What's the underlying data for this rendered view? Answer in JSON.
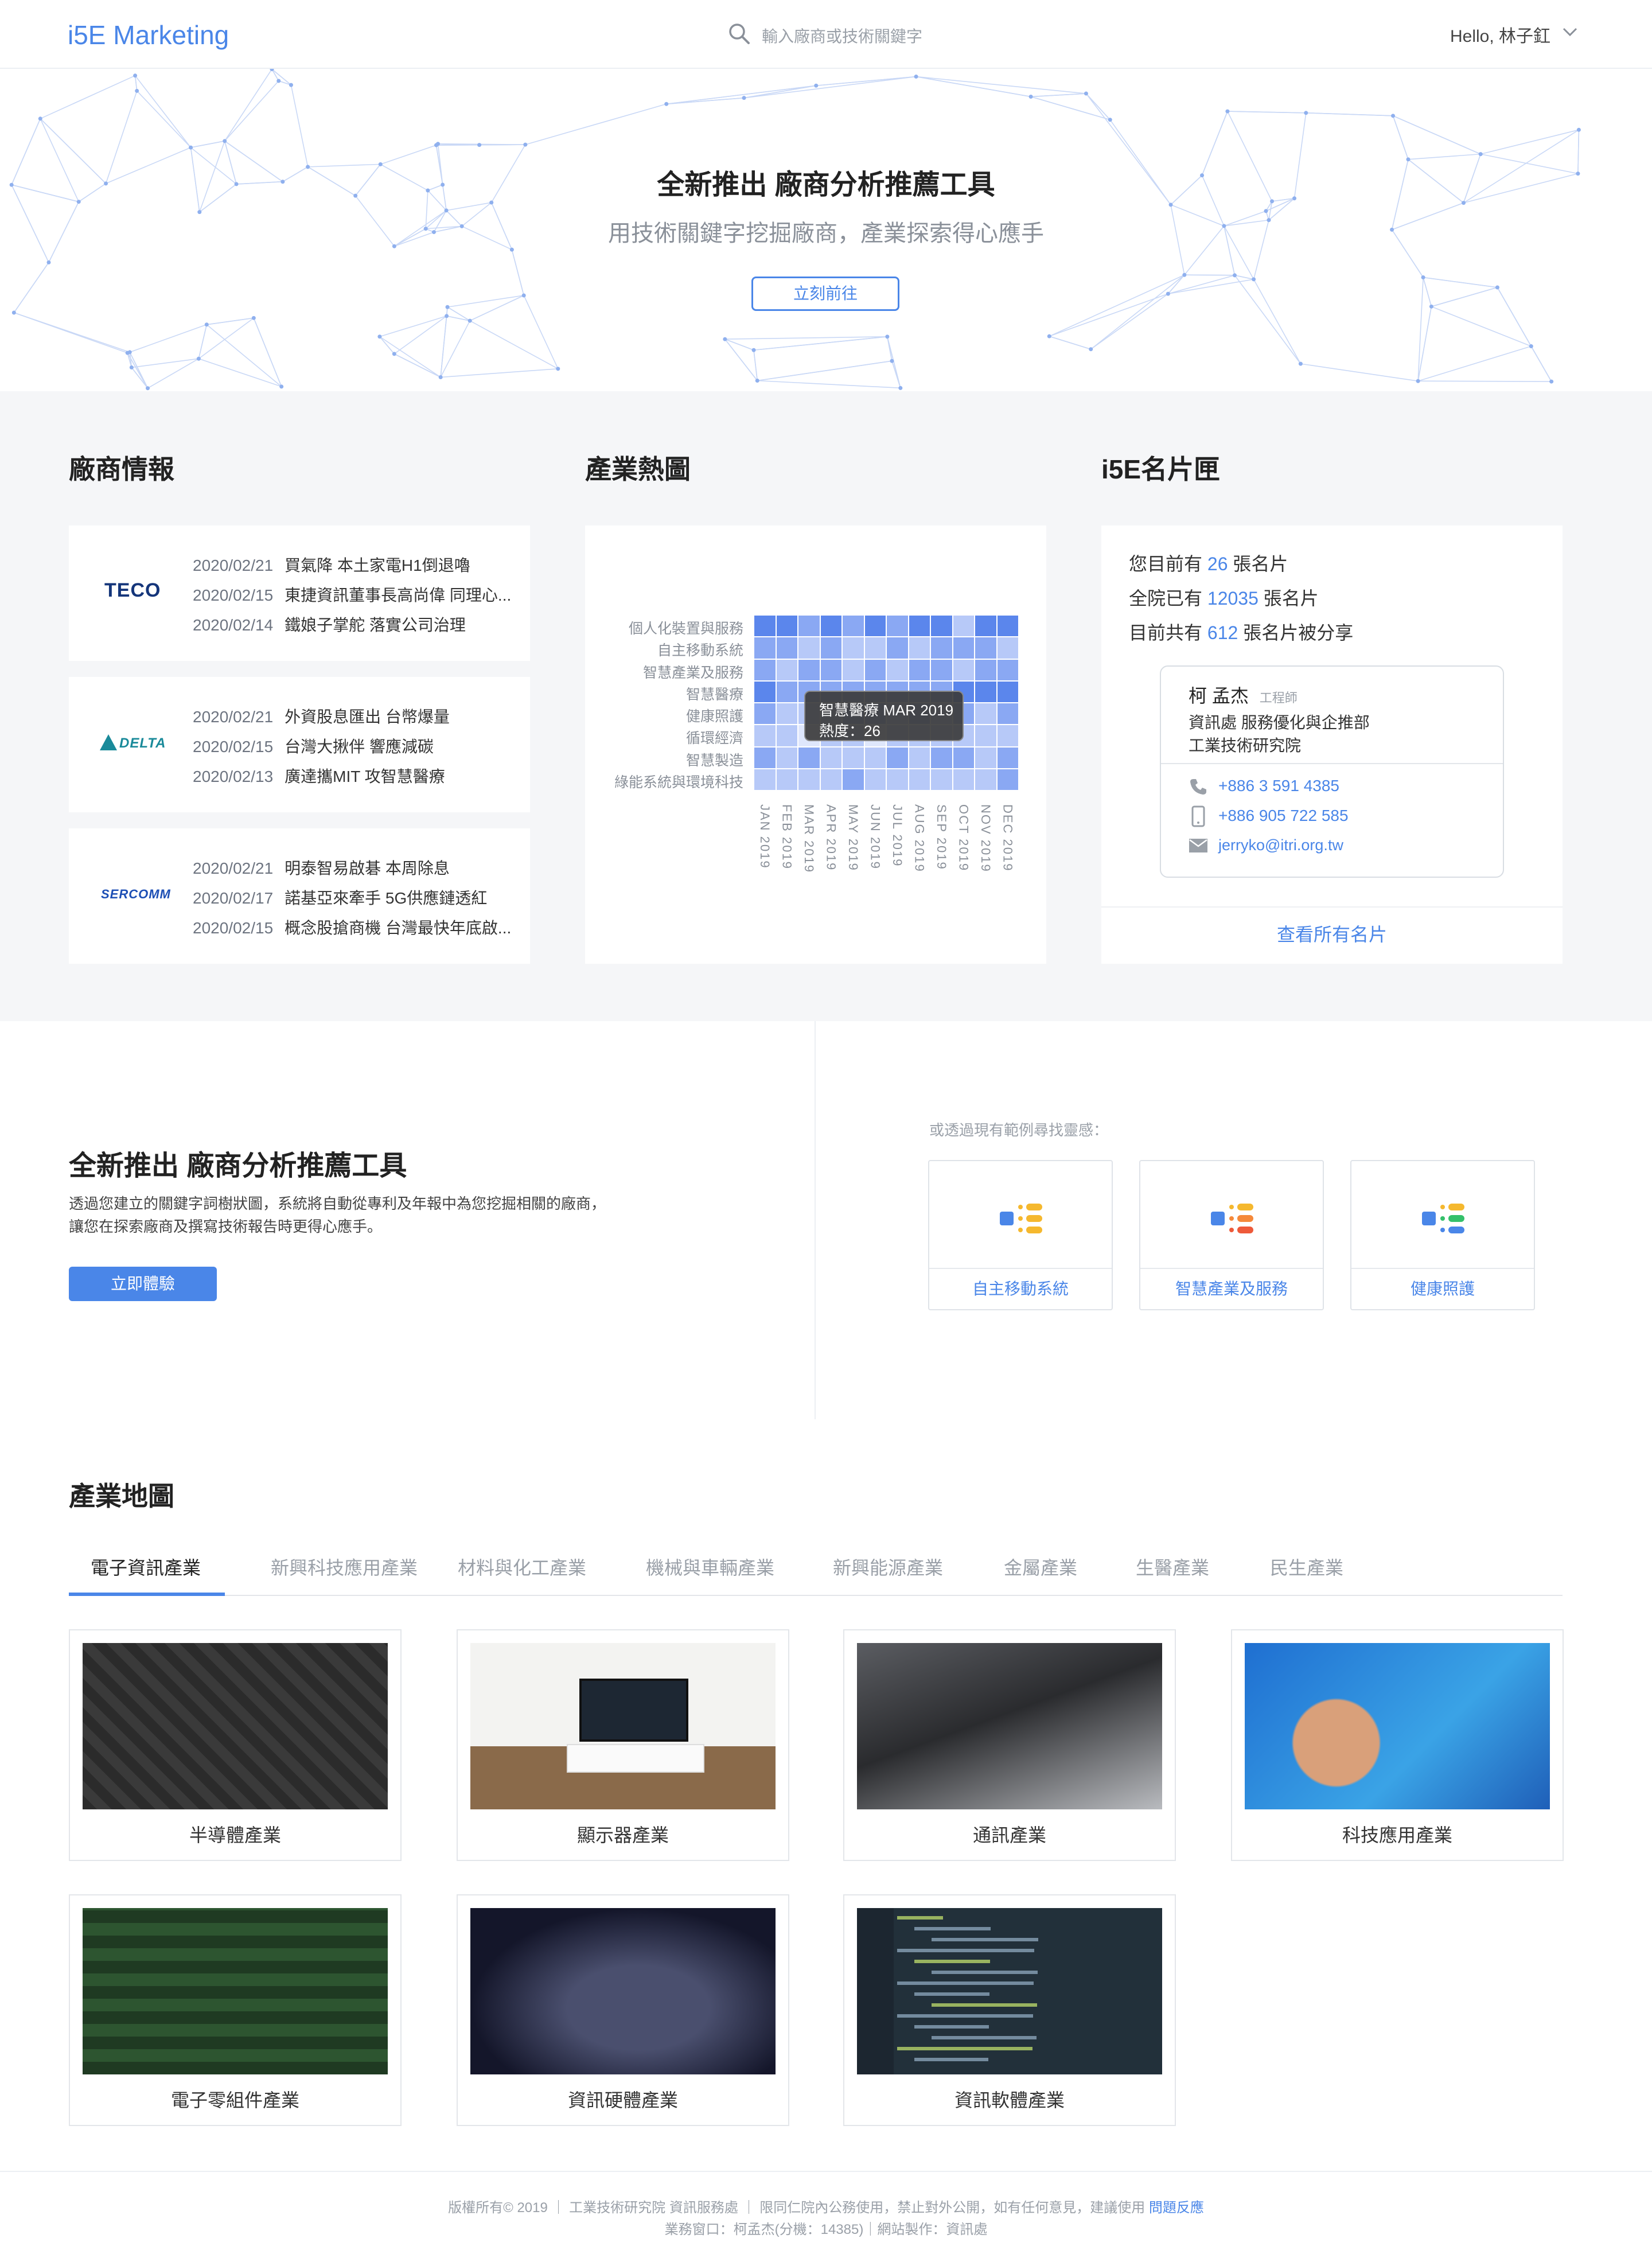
{
  "header": {
    "logo": "i5E Marketing",
    "search_placeholder": "輸入廠商或技術關鍵字",
    "user_greeting": "Hello, 林子釭"
  },
  "hero": {
    "title": "全新推出 廠商分析推薦工具",
    "subtitle": "用技術關鍵字挖掘廠商，產業探索得心應手",
    "button": "立刻前往"
  },
  "vendor_news": {
    "title": "廠商情報",
    "cards": [
      {
        "logo": "TECO",
        "items": [
          {
            "date": "2020/02/21",
            "text": "買氣降 本土家電H1倒退嚕"
          },
          {
            "date": "2020/02/15",
            "text": "東捷資訊董事長高尚偉 同理心..."
          },
          {
            "date": "2020/02/14",
            "text": "鐵娘子掌舵 落實公司治理"
          }
        ]
      },
      {
        "logo": "DELTA",
        "items": [
          {
            "date": "2020/02/21",
            "text": "外資股息匯出 台幣爆量"
          },
          {
            "date": "2020/02/15",
            "text": "台灣大揪伴 響應減碳"
          },
          {
            "date": "2020/02/13",
            "text": "廣達攜MIT 攻智慧醫療"
          }
        ]
      },
      {
        "logo": "SERCOMM",
        "items": [
          {
            "date": "2020/02/21",
            "text": "明泰智易啟碁 本周除息"
          },
          {
            "date": "2020/02/17",
            "text": "諾基亞來牽手 5G供應鏈透紅"
          },
          {
            "date": "2020/02/15",
            "text": "概念股搶商機 台灣最快年底啟..."
          }
        ]
      }
    ]
  },
  "heatmap": {
    "title": "產業熱圖",
    "rows": [
      "個人化裝置與服務",
      "自主移動系統",
      "智慧產業及服務",
      "智慧醫療",
      "健康照護",
      "循環經濟",
      "智慧製造",
      "綠能系統與環境科技"
    ],
    "months": [
      "JAN 2019",
      "FEB 2019",
      "MAR 2019",
      "APR 2019",
      "MAY 2019",
      "JUN 2019",
      "JUL 2019",
      "AUG 2019",
      "SEP 2019",
      "OCT 2019",
      "NOV 2019",
      "DEC 2019"
    ],
    "tooltip_title": "智慧醫療 MAR 2019",
    "tooltip_value": "熱度：26",
    "colors": [
      "#ffffff",
      "#dfe7fc",
      "#b7c9f8",
      "#8aa8f3",
      "#5b86ec"
    ]
  },
  "chart_data": {
    "type": "heatmap",
    "x": [
      "JAN 2019",
      "FEB 2019",
      "MAR 2019",
      "APR 2019",
      "MAY 2019",
      "JUN 2019",
      "JUL 2019",
      "AUG 2019",
      "SEP 2019",
      "OCT 2019",
      "NOV 2019",
      "DEC 2019"
    ],
    "y": [
      "個人化裝置與服務",
      "自主移動系統",
      "智慧產業及服務",
      "智慧醫療",
      "健康照護",
      "循環經濟",
      "智慧製造",
      "綠能系統與環境科技"
    ],
    "levels": [
      [
        4,
        4,
        3,
        4,
        3,
        4,
        3,
        4,
        4,
        2,
        4,
        4
      ],
      [
        3,
        3,
        2,
        3,
        2,
        2,
        3,
        2,
        3,
        3,
        3,
        2
      ],
      [
        3,
        2,
        3,
        3,
        2,
        3,
        2,
        3,
        3,
        2,
        3,
        3
      ],
      [
        4,
        3,
        3,
        3,
        3,
        3,
        3,
        3,
        3,
        4,
        4,
        4
      ],
      [
        3,
        2,
        2,
        2,
        3,
        3,
        2,
        3,
        2,
        3,
        2,
        3
      ],
      [
        2,
        2,
        1,
        2,
        2,
        1,
        2,
        2,
        2,
        2,
        2,
        2
      ],
      [
        3,
        2,
        3,
        2,
        2,
        2,
        3,
        2,
        3,
        3,
        2,
        3
      ],
      [
        2,
        2,
        2,
        2,
        3,
        2,
        2,
        2,
        2,
        2,
        2,
        3
      ]
    ],
    "tooltip": {
      "row": "智慧醫療",
      "month": "MAR 2019",
      "value": 26
    }
  },
  "business_cards": {
    "title": "i5E名片匣",
    "stat1_pre": "您目前有",
    "stat1_num": "26",
    "stat1_post": "張名片",
    "stat2_pre": "全院已有",
    "stat2_num": "12035",
    "stat2_post": "張名片",
    "stat3_pre": "目前共有",
    "stat3_num": "612",
    "stat3_post": "張名片被分享",
    "card": {
      "name": "柯 孟杰",
      "role": "工程師",
      "dept": "資訊處 服務優化與企推部",
      "org": "工業技術研究院",
      "phone": "+886 3 591 4385",
      "mobile": "+886 905 722 585",
      "email": "jerryko@itri.org.tw"
    },
    "view_all": "查看所有名片"
  },
  "promo": {
    "title": "全新推出 廠商分析推薦工具",
    "desc_line1": "透過您建立的關鍵字詞樹狀圖，系統將自動從專利及年報中為您挖掘相關的廠商，",
    "desc_line2": "讓您在探索廠商及撰寫技術報告時更得心應手。",
    "button": "立即體驗",
    "examples_title": "或透過現有範例尋找靈感：",
    "examples": [
      {
        "label": "自主移動系統",
        "colors": [
          "#4a86e8",
          "#f5b82e",
          "#f5b82e",
          "#f5b82e"
        ]
      },
      {
        "label": "智慧產業及服務",
        "colors": [
          "#4a86e8",
          "#f5b82e",
          "#f5893a",
          "#ee5a3a"
        ]
      },
      {
        "label": "健康照護",
        "colors": [
          "#4a86e8",
          "#f5b82e",
          "#34c06a",
          "#4a86e8"
        ]
      }
    ]
  },
  "industry_map": {
    "title": "產業地圖",
    "tabs": [
      "電子資訊產業",
      "新興科技應用產業",
      "材料與化工產業",
      "機械與車輛產業",
      "新興能源產業",
      "金屬產業",
      "生醫產業",
      "民生產業"
    ],
    "active_tab": "電子資訊產業",
    "cards": [
      "半導體產業",
      "顯示器產業",
      "通訊產業",
      "科技應用產業",
      "電子零組件產業",
      "資訊硬體產業",
      "資訊軟體產業"
    ]
  },
  "footer": {
    "line1": "版權所有© 2019 ｜ 工業技術研究院 資訊服務處 ｜ 限同仁院內公務使用，禁止對外公開，如有任何意見，建議使用",
    "feedback_link": "問題反應",
    "line2": "業務窗口：柯孟杰(分機：14385)｜網站製作：資訊處"
  },
  "colors": {
    "accent": "#4a86e8",
    "band_bg": "#f5f6f8",
    "text_dark": "#222222",
    "text_muted": "#9aa0a8"
  }
}
